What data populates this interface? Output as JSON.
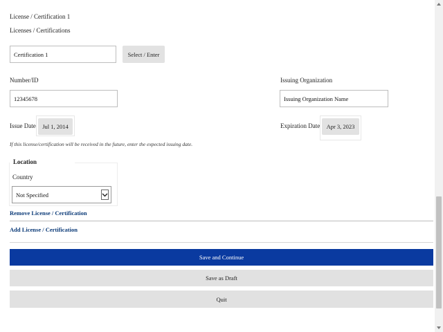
{
  "license": {
    "heading": "License / Certification 1",
    "licenses_label": "Licenses / Certifications",
    "certification_value": "Certification 1",
    "select_button": "Select / Enter",
    "number_label": "Number/ID",
    "number_value": "12345678",
    "org_label": "Issuing Organization",
    "org_value": "Issuing Organization Name",
    "issue_date_label": "Issue Date",
    "issue_date_value": "Jul 1, 2014",
    "expiration_label": "Expiration Date",
    "expiration_value": "Apr 3, 2023",
    "future_note": "If this license/certification will be received in the future, enter the expected issuing date."
  },
  "location": {
    "legend": "Location",
    "country_label": "Country",
    "country_value": "Not Specified"
  },
  "links": {
    "remove": "Remove License / Certification",
    "add": "Add License / Certification"
  },
  "actions": {
    "save_continue": "Save and Continue",
    "save_draft": "Save as Draft",
    "quit": "Quit"
  },
  "colors": {
    "primary": "#0a3aa0",
    "link": "#0c3b78",
    "secondary": "#e1e1e1"
  },
  "icons": {
    "dropdown": "chevron-down-icon",
    "scroll_up": "scroll-up-arrow-icon",
    "scroll_down": "scroll-down-arrow-icon"
  }
}
